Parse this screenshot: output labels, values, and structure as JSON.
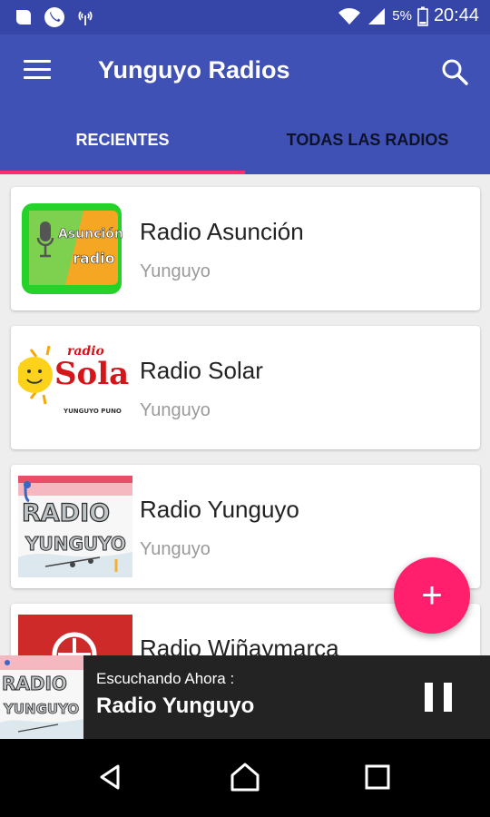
{
  "status_bar": {
    "battery_percent": "5%",
    "time": "20:44"
  },
  "app_bar": {
    "title": "Yunguyo Radios"
  },
  "tabs": [
    {
      "label": "RECIENTES",
      "active": true
    },
    {
      "label": "TODAS LAS RADIOS",
      "active": false
    }
  ],
  "stations": [
    {
      "name": "Radio Asunción",
      "location": "Yunguyo",
      "logo_text": [
        "Asunción",
        "radio"
      ]
    },
    {
      "name": "Radio Solar",
      "location": "Yunguyo",
      "logo_text": [
        "radio",
        "Sola",
        "YUNGUYO PUNO"
      ]
    },
    {
      "name": "Radio Yunguyo",
      "location": "Yunguyo",
      "logo_text": [
        "RADIO",
        "YUNGUYO"
      ]
    },
    {
      "name": "Radio Wiñaymarca",
      "location": "",
      "logo_text": []
    }
  ],
  "fab": {
    "label": "+"
  },
  "now_playing": {
    "label": "Escuchando Ahora :",
    "station": "Radio Yunguyo",
    "logo_text": [
      "RADIO",
      "YUNGUYO"
    ]
  },
  "colors": {
    "primary": "#3f51b5",
    "primary_dark": "#3546a8",
    "accent": "#ff1f6d",
    "player_bg": "#232323"
  },
  "icons": {
    "menu": "hamburger-icon",
    "search": "search-icon",
    "add": "plus-icon",
    "pause": "pause-icon",
    "nav_back": "back-triangle-icon",
    "nav_home": "home-icon",
    "nav_recents": "square-icon"
  }
}
